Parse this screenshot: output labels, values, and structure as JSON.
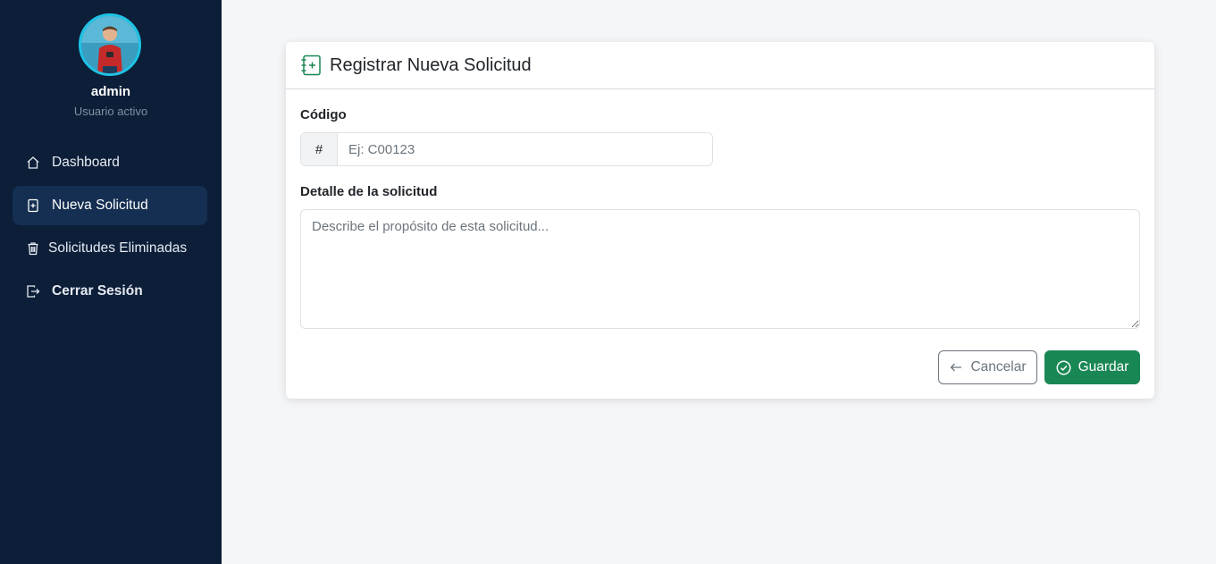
{
  "sidebar": {
    "user": {
      "name": "admin",
      "status": "Usuario activo"
    },
    "items": [
      {
        "label": "Dashboard",
        "icon": "house-icon"
      },
      {
        "label": "Nueva Solicitud",
        "icon": "file-plus-icon",
        "active": true
      },
      {
        "label": "Solicitudes Eliminadas",
        "icon": "trash-icon"
      },
      {
        "label": "Cerrar Sesión",
        "icon": "logout-icon"
      }
    ]
  },
  "form": {
    "title": "Registrar Nueva Solicitud",
    "title_icon": "journal-plus-icon",
    "code": {
      "label": "Código",
      "prefix": "#",
      "placeholder": "Ej: C00123",
      "value": ""
    },
    "detail": {
      "label": "Detalle de la solicitud",
      "placeholder": "Describe el propósito de esta solicitud...",
      "value": ""
    },
    "cancel_label": "Cancelar",
    "cancel_icon": "arrow-left-icon",
    "save_label": "Guardar",
    "save_icon": "check-circle-icon"
  },
  "colors": {
    "sidebar_bg": "#0c1e38",
    "sidebar_active": "#142f51",
    "accent_green": "#198754",
    "avatar_ring": "#1ec3e6",
    "page_bg": "#f5f6f8"
  }
}
